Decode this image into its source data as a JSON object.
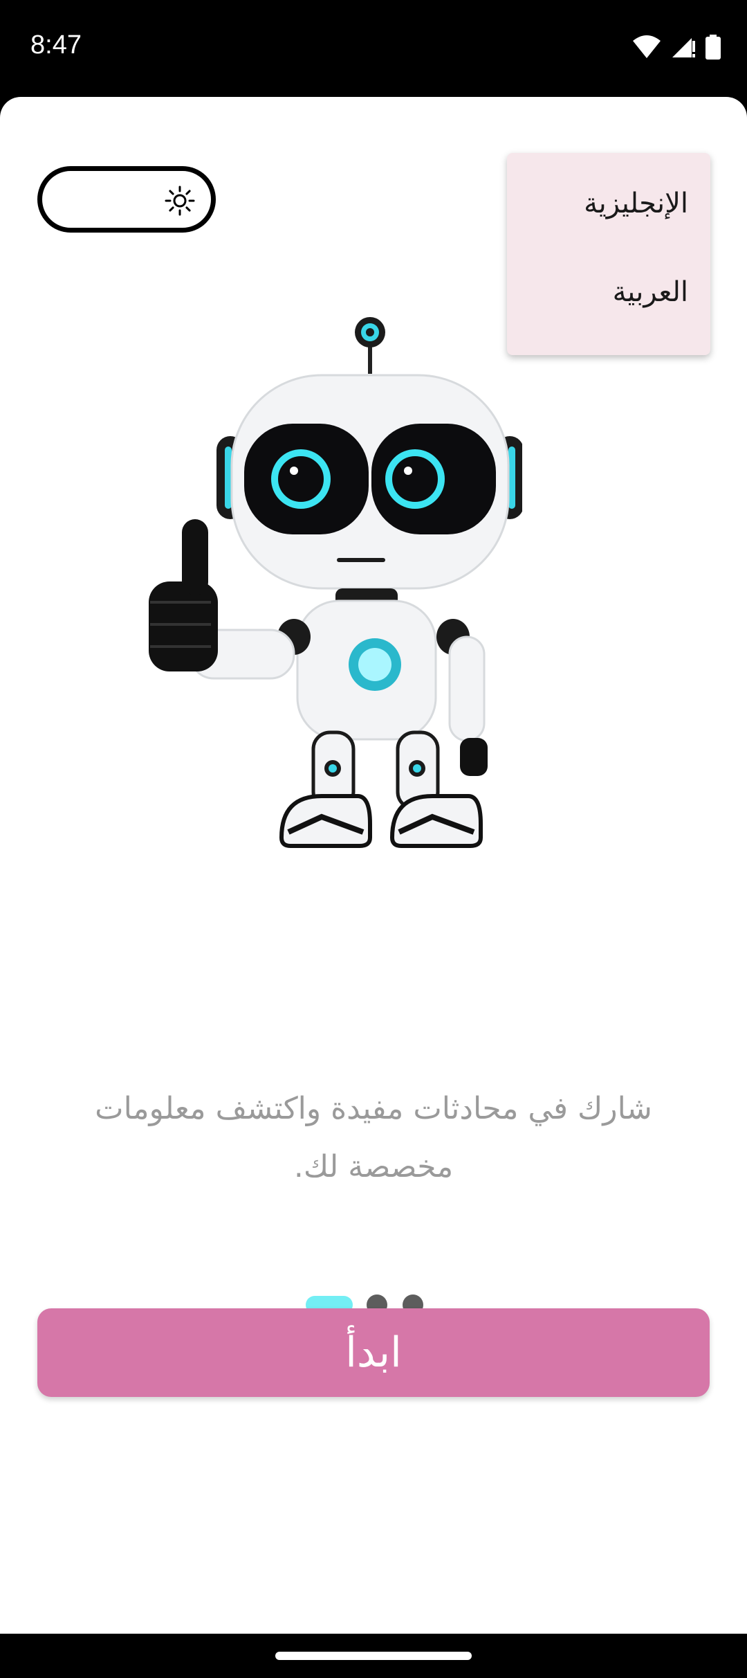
{
  "status_bar": {
    "time": "8:47"
  },
  "language_menu": {
    "english": "الإنجليزية",
    "arabic": "العربية"
  },
  "onboarding": {
    "description": "شارك في محادثات مفيدة واكتشف معلومات مخصصة لك.",
    "page_indicator": {
      "current": 1,
      "total": 3
    }
  },
  "start_button": {
    "label": "ابدأ"
  },
  "colors": {
    "accent_button": "#d677a8",
    "indicator_active": "#73eef4",
    "indicator_inactive": "#5d5d5d",
    "menu_background": "#f6e7eb"
  }
}
